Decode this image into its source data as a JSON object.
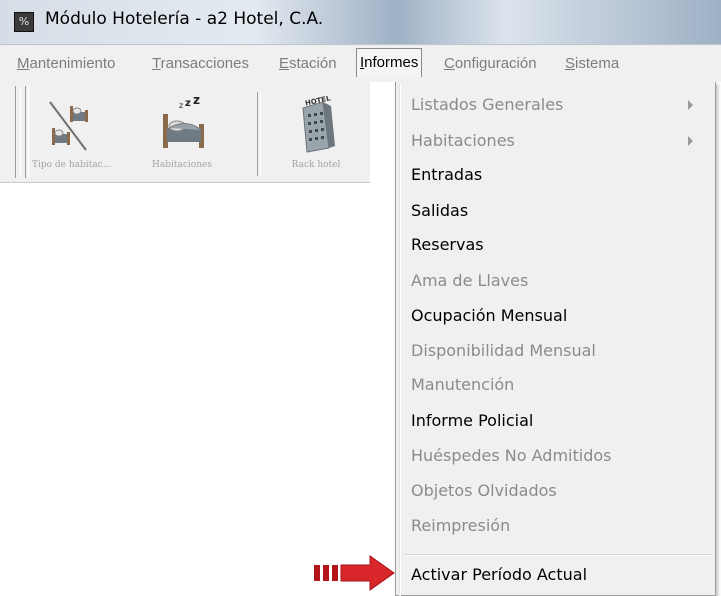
{
  "window": {
    "title": "Módulo Hotelería - a2 Hotel, C.A.",
    "icon": "app-logo-icon"
  },
  "menubar": {
    "items": [
      {
        "label": "Mantenimiento",
        "accel": "M",
        "rest": "antenimiento"
      },
      {
        "label": "Transacciones",
        "accel": "T",
        "rest": "ransacciones"
      },
      {
        "label": "Estación",
        "accel": "E",
        "rest": "stación"
      },
      {
        "label": "Informes",
        "accel": "I",
        "rest": "nformes",
        "active": true
      },
      {
        "label": "Configuración",
        "accel": "C",
        "rest": "onfiguración"
      },
      {
        "label": "Sistema",
        "accel": "S",
        "rest": "istema"
      }
    ]
  },
  "toolbar": {
    "buttons": [
      {
        "label": "Tipo de habitac...",
        "icon": "room-type-icon"
      },
      {
        "label": "Habitaciones",
        "icon": "bed-icon"
      },
      {
        "label": "Rack hotel",
        "icon": "hotel-building-icon"
      }
    ]
  },
  "dropdown": {
    "items": [
      {
        "label": "Listados Generales",
        "enabled": false,
        "submenu": true
      },
      {
        "label": "Habitaciones",
        "enabled": false,
        "submenu": true
      },
      {
        "label": "Entradas",
        "enabled": true
      },
      {
        "label": "Salidas",
        "enabled": true
      },
      {
        "label": "Reservas",
        "enabled": true
      },
      {
        "label": "Ama de Llaves",
        "enabled": false
      },
      {
        "label": "Ocupación Mensual",
        "enabled": true
      },
      {
        "label": "Disponibilidad Mensual",
        "enabled": false
      },
      {
        "label": "Manutención",
        "enabled": false
      },
      {
        "label": "Informe Policial",
        "enabled": true
      },
      {
        "label": "Huéspedes No Admitidos",
        "enabled": false
      },
      {
        "label": "Objetos Olvidados",
        "enabled": false
      },
      {
        "label": "Reimpresión",
        "enabled": false
      },
      {
        "label": "Activar Período Actual",
        "enabled": true
      }
    ]
  },
  "colors": {
    "enabled_text": "#000000",
    "disabled_text": "#8b8b8b",
    "pointer_arrow": "#d9262a"
  }
}
